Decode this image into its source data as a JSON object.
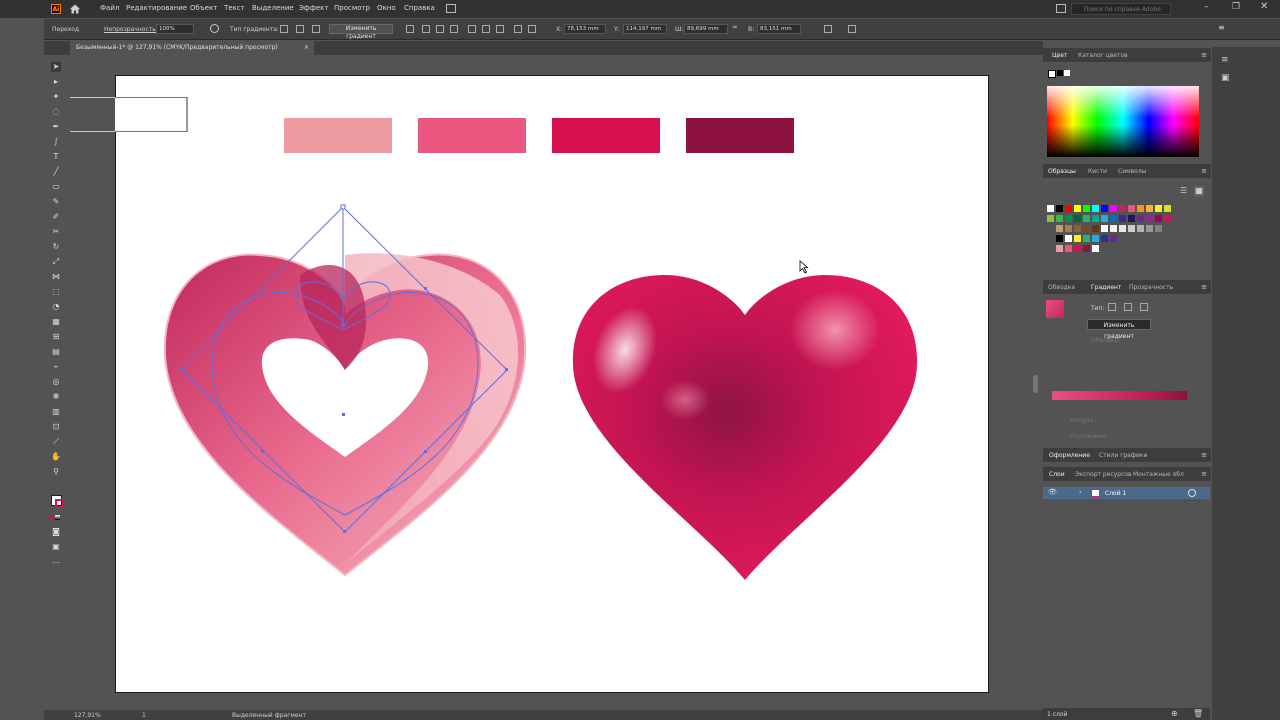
{
  "app": {
    "logo": "Ai"
  },
  "menu": [
    "Файл",
    "Редактирование",
    "Объект",
    "Текст",
    "Выделение",
    "Эффект",
    "Просмотр",
    "Окно",
    "Справка"
  ],
  "search": {
    "placeholder": "Поиск по справке Adobe"
  },
  "control": {
    "mode_label": "Переход",
    "opacity_label": "Непрозрачность:",
    "opacity_value": "100%",
    "gradient_type_label": "Тип градиента:",
    "edit_gradient": "Изменить градиент",
    "x_label": "X:",
    "x_value": "78,153 mm",
    "y_label": "Y:",
    "y_value": "114,197 mm",
    "w_label": "Ш:",
    "w_value": "89,699 mm",
    "h_label": "В:",
    "h_value": "83,151 mm"
  },
  "document": {
    "tab_title": "Безымянный-1* @ 127,91% (CMYK/Предварительный просмотр)",
    "close": "×"
  },
  "canvas": {
    "palette": [
      "#ef9ba3",
      "#e95680",
      "#d8104e",
      "#8c1240"
    ]
  },
  "status": {
    "zoom": "127,91%",
    "page": "1",
    "mode": "Выделенный фрагмент"
  },
  "panels": {
    "color": {
      "tabs": [
        "Цвет",
        "Каталог цветов"
      ]
    },
    "swatches": {
      "tabs": [
        "Образцы",
        "Кисти",
        "Символы"
      ]
    },
    "gradient": {
      "tabs": [
        "Обводка",
        "Градиент",
        "Прозрачность"
      ],
      "type_label": "Тип:",
      "edit_gradient": "Изменить градиент",
      "stroke_label": "Обводка:",
      "opacity_label": "Непроз.:",
      "location_label": "Положение:"
    },
    "appearance": {
      "tabs": [
        "Оформление",
        "Стили графики"
      ]
    },
    "layers": {
      "tabs": [
        "Слои",
        "Экспорт ресурсов",
        "Монтажные обл"
      ],
      "items": [
        {
          "name": "Слой 1"
        }
      ],
      "footer": "1 слой"
    }
  },
  "colors": {
    "accent": "#4b6a8b",
    "selection": "#4f64d6",
    "brand": "#ff9a00"
  }
}
